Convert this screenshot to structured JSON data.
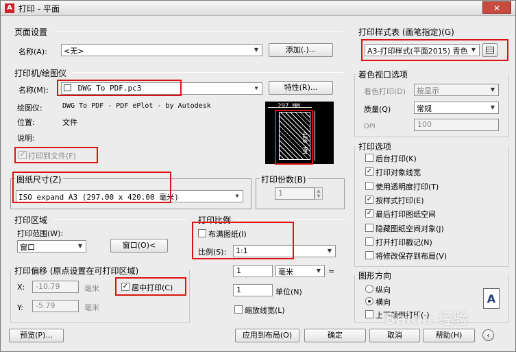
{
  "titlebar": {
    "title": "打印 - 平面",
    "close": "✕"
  },
  "page_setup": {
    "group": "页面设置",
    "name_label": "名称(A):",
    "name_value": "<无>",
    "add_button": "添加(.)..."
  },
  "printer": {
    "group": "打印机/绘图仪",
    "name_label": "名称(M):",
    "name_value": "DWG To PDF.pc3",
    "properties_button": "特性(R)...",
    "plotter_label": "绘图仪:",
    "plotter_value": "DWG To PDF - PDF ePlot - by Autodesk",
    "location_label": "位置:",
    "location_value": "文件",
    "description_label": "说明:",
    "print_to_file": "打印到文件(F)",
    "preview_width": "297 MM",
    "preview_height": "420 MM"
  },
  "paper_size": {
    "group": "图纸尺寸(Z)",
    "value": "ISO expand A3 (297.00 x 420.00 毫米)"
  },
  "copies": {
    "group": "打印份数(B)",
    "value": "1"
  },
  "plot_area": {
    "group": "打印区域",
    "range_label": "打印范围(W):",
    "range_value": "窗口",
    "window_button": "窗口(O)<"
  },
  "plot_scale": {
    "group": "打印比例",
    "fit_paper": "布满图纸(I)",
    "scale_label": "比例(S):",
    "scale_value": "1:1",
    "value1": "1",
    "unit_value": "毫米",
    "equals": "=",
    "value2": "1",
    "unit_label": "单位(N)",
    "scale_lineweights": "缩放线宽(L)"
  },
  "plot_offset": {
    "group": "打印偏移 (原点设置在可打印区域)",
    "x_label": "X:",
    "x_value": "-10.79",
    "x_unit": "毫米",
    "y_label": "Y:",
    "y_value": "-5.79",
    "y_unit": "毫米",
    "center_plot": "居中打印(C)"
  },
  "plot_style_table": {
    "group": "打印样式表 (画笔指定)(G)",
    "value": "A3-打印样式(平面2015) 青色"
  },
  "shaded_viewport": {
    "group": "着色视口选项",
    "shade_label": "着色打印(D)",
    "shade_value": "按显示",
    "quality_label": "质量(Q)",
    "quality_value": "常规",
    "dpi_label": "DPI",
    "dpi_value": "100"
  },
  "plot_options": {
    "group": "打印选项",
    "items": [
      {
        "label": "后台打印(K)",
        "checked": false
      },
      {
        "label": "打印对象线宽",
        "checked": true
      },
      {
        "label": "使用透明度打印(T)",
        "checked": false
      },
      {
        "label": "按样式打印(E)",
        "checked": true
      },
      {
        "label": "最后打印图纸空间",
        "checked": true
      },
      {
        "label": "隐藏图纸空间对象(J)",
        "checked": false
      },
      {
        "label": "打开打印戳记(N)",
        "checked": false
      },
      {
        "label": "将修改保存到布局(V)",
        "checked": false
      }
    ]
  },
  "orientation": {
    "group": "图形方向",
    "portrait": "纵向",
    "landscape": "横向",
    "upside_down": "上下颠倒打印(-)",
    "icon_letter": "A"
  },
  "footer": {
    "preview": "预览(P)...",
    "apply_layout": "应用到布局(O)",
    "ok": "确定",
    "cancel": "取消",
    "help": "帮助(H)",
    "watermark": "Baidu 经验"
  }
}
